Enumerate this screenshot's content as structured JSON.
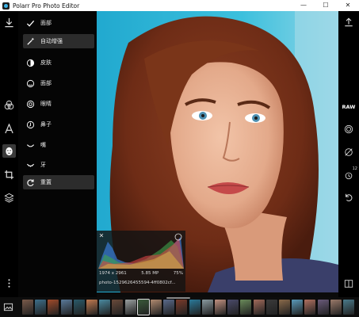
{
  "window": {
    "title": "Polarr Pro Photo Editor",
    "controls": [
      "—",
      "☐",
      "✕"
    ]
  },
  "menu": {
    "header_label": "面部",
    "items": [
      {
        "label": "自动增强",
        "icon": "magic-wand-icon",
        "selected": true
      },
      {
        "label": "皮肤",
        "icon": "half-circle-icon",
        "selected": false
      },
      {
        "label": "面部",
        "icon": "face-outline-icon",
        "selected": false
      },
      {
        "label": "眼睛",
        "icon": "eye-icon",
        "selected": false
      },
      {
        "label": "鼻子",
        "icon": "nose-icon",
        "selected": false
      },
      {
        "label": "嘴",
        "icon": "mouth-icon",
        "selected": false
      },
      {
        "label": "牙",
        "icon": "teeth-icon",
        "selected": false
      },
      {
        "label": "重置",
        "icon": "reset-icon",
        "selected": true
      }
    ]
  },
  "histogram": {
    "dimensions": "1974 x 2961",
    "megapixels": "5.85 MP",
    "zoom": "75%",
    "filename": "photo-1529626455594-4ff0802cf..."
  },
  "right_rail": {
    "raw_label": "RAW",
    "history_badge": "12"
  },
  "colors": {
    "accent": "#3bb3e6",
    "panel_bg": "#050505",
    "selected_bg": "#2c2c2c",
    "photo_bg": "#2ab5d8"
  }
}
